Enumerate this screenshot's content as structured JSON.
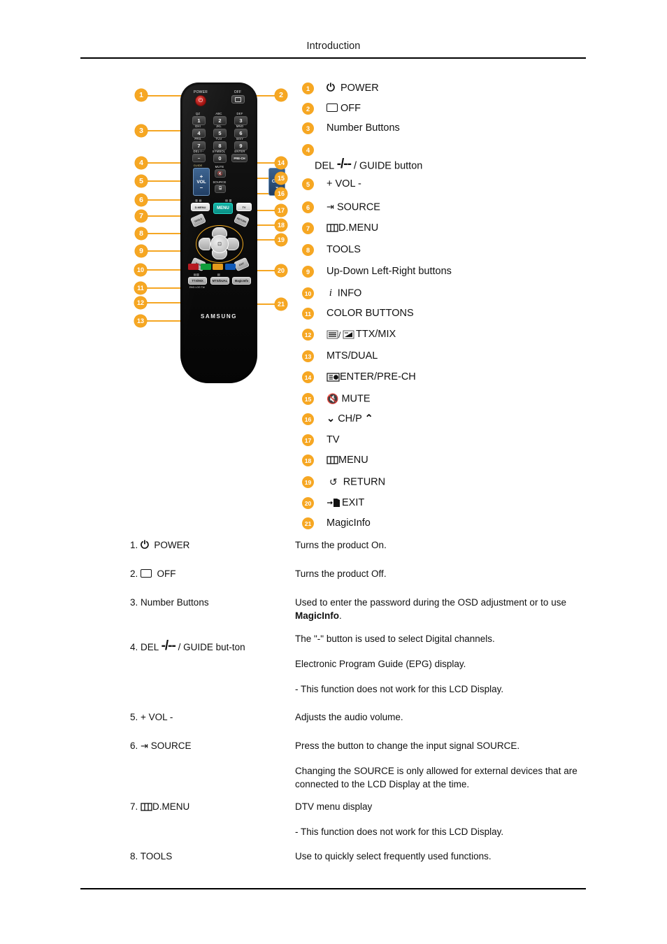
{
  "header": {
    "title": "Introduction"
  },
  "figure": {
    "remote_brand": "SAMSUNG",
    "remote_labels": {
      "power": "POWER",
      "off": "OFF",
      "num_top": [
        "QZ",
        "ABC",
        "DEF"
      ],
      "num_mid": [
        "GHI",
        "JKL",
        "MNO"
      ],
      "num_bot": [
        "PRS",
        "TUV",
        "WXY"
      ],
      "keys": [
        "1",
        "2",
        "3",
        "4",
        "5",
        "6",
        "7",
        "8",
        "9"
      ],
      "del": "DEL-/--",
      "symbol": "SYMBOL",
      "zero": "0",
      "enter": "ENTER",
      "prech": "PRE-CH",
      "guide": "GUIDE",
      "vol": "VOL",
      "vol_plus": "+",
      "vol_minus": "–",
      "mute": "MUTE",
      "source": "SOURCE",
      "chp": "CH/P",
      "dmenu": "D.MENU",
      "menu": "MENU",
      "tv": "TV",
      "tools": "TOOLS",
      "info": "INFO",
      "return": "RETURN",
      "exit": "EXIT",
      "ttx_mix": "TTX/MIX",
      "mts_dual": "MTS/DUAL",
      "magicinfo": "MagicInfo",
      "sub_ttx": "ENG.LOG TA/"
    },
    "color_buttons": [
      "#b5181f",
      "#0f9d3a",
      "#e39a1a",
      "#1059b7"
    ],
    "callout_color": "#f5a623",
    "left_callouts": [
      "1",
      "3",
      "4",
      "5",
      "6",
      "7",
      "8",
      "9",
      "10",
      "11",
      "12",
      "13"
    ],
    "right_callouts": [
      "2",
      "14",
      "15",
      "16",
      "17",
      "18",
      "19",
      "20",
      "21"
    ]
  },
  "legend": [
    {
      "n": "1",
      "icon": "power-icon",
      "text": "POWER"
    },
    {
      "n": "2",
      "icon": "off-square-icon",
      "text": "OFF"
    },
    {
      "n": "3",
      "icon": "",
      "text": "Number Buttons"
    },
    {
      "n": "4",
      "icon": "del-dash-icon",
      "text": "DEL",
      "text2": "/ GUIDE button"
    },
    {
      "n": "5",
      "icon": "",
      "text": "+ VOL -"
    },
    {
      "n": "6",
      "icon": "source-icon",
      "text": "SOURCE"
    },
    {
      "n": "7",
      "icon": "menu-bars-icon",
      "text": "D.MENU"
    },
    {
      "n": "8",
      "icon": "",
      "text": "TOOLS"
    },
    {
      "n": "9",
      "icon": "",
      "text": "Up-Down Left-Right buttons"
    },
    {
      "n": "10",
      "icon": "info-icon",
      "text": "INFO"
    },
    {
      "n": "11",
      "icon": "",
      "text": "COLOR BUTTONS"
    },
    {
      "n": "12",
      "icon": "ttx-mix-icon",
      "text": "TTX/MIX"
    },
    {
      "n": "13",
      "icon": "",
      "text": "MTS/DUAL"
    },
    {
      "n": "14",
      "icon": "enter-prech-icon",
      "text": "ENTER/PRE-CH"
    },
    {
      "n": "15",
      "icon": "mute-icon",
      "text": "MUTE"
    },
    {
      "n": "16",
      "icon": "chevron-updown",
      "text": "CH/P"
    },
    {
      "n": "17",
      "icon": "",
      "text": "TV"
    },
    {
      "n": "18",
      "icon": "menu-bars-icon",
      "text": "MENU"
    },
    {
      "n": "19",
      "icon": "return-arrow-icon",
      "text": "RETURN"
    },
    {
      "n": "20",
      "icon": "exit-door-icon",
      "text": "EXIT"
    },
    {
      "n": "21",
      "icon": "",
      "text": "MagicInfo"
    }
  ],
  "descriptions": [
    {
      "num": "1.",
      "label": "POWER",
      "icon": "power-icon",
      "paras": [
        "Turns the product On."
      ]
    },
    {
      "num": "2.",
      "label": "OFF",
      "icon": "off-square-icon",
      "paras": [
        "Turns the product Off."
      ]
    },
    {
      "num": "3.",
      "label": "Number Buttons",
      "icon": "",
      "paras": [
        "Used to enter the password during the OSD adjustment or to use MagicInfo."
      ],
      "bold_terms": [
        "MagicInfo"
      ]
    },
    {
      "num": "4.",
      "label": "DEL",
      "label2": "/ GUIDE but-ton",
      "icon": "del-dash-icon",
      "paras": [
        "The \"-\" button is used to select Digital channels.",
        "Electronic Program Guide (EPG) display.",
        "- This function does not work for this LCD Display."
      ]
    },
    {
      "num": "5.",
      "label": "+ VOL -",
      "icon": "",
      "paras": [
        "Adjusts the audio volume."
      ]
    },
    {
      "num": "6.",
      "label": "SOURCE",
      "icon": "source-icon",
      "paras": [
        "Press the button to change the input signal SOURCE.",
        "Changing the SOURCE is only allowed for external devices that are connected to the LCD Display at the time."
      ]
    },
    {
      "num": "7.",
      "label": "D.MENU",
      "icon": "menu-bars-icon",
      "paras": [
        "DTV menu display",
        "- This function does not work for this LCD Display."
      ]
    },
    {
      "num": "8.",
      "label": "TOOLS",
      "icon": "",
      "paras": [
        "Use to quickly select frequently used functions."
      ]
    }
  ]
}
